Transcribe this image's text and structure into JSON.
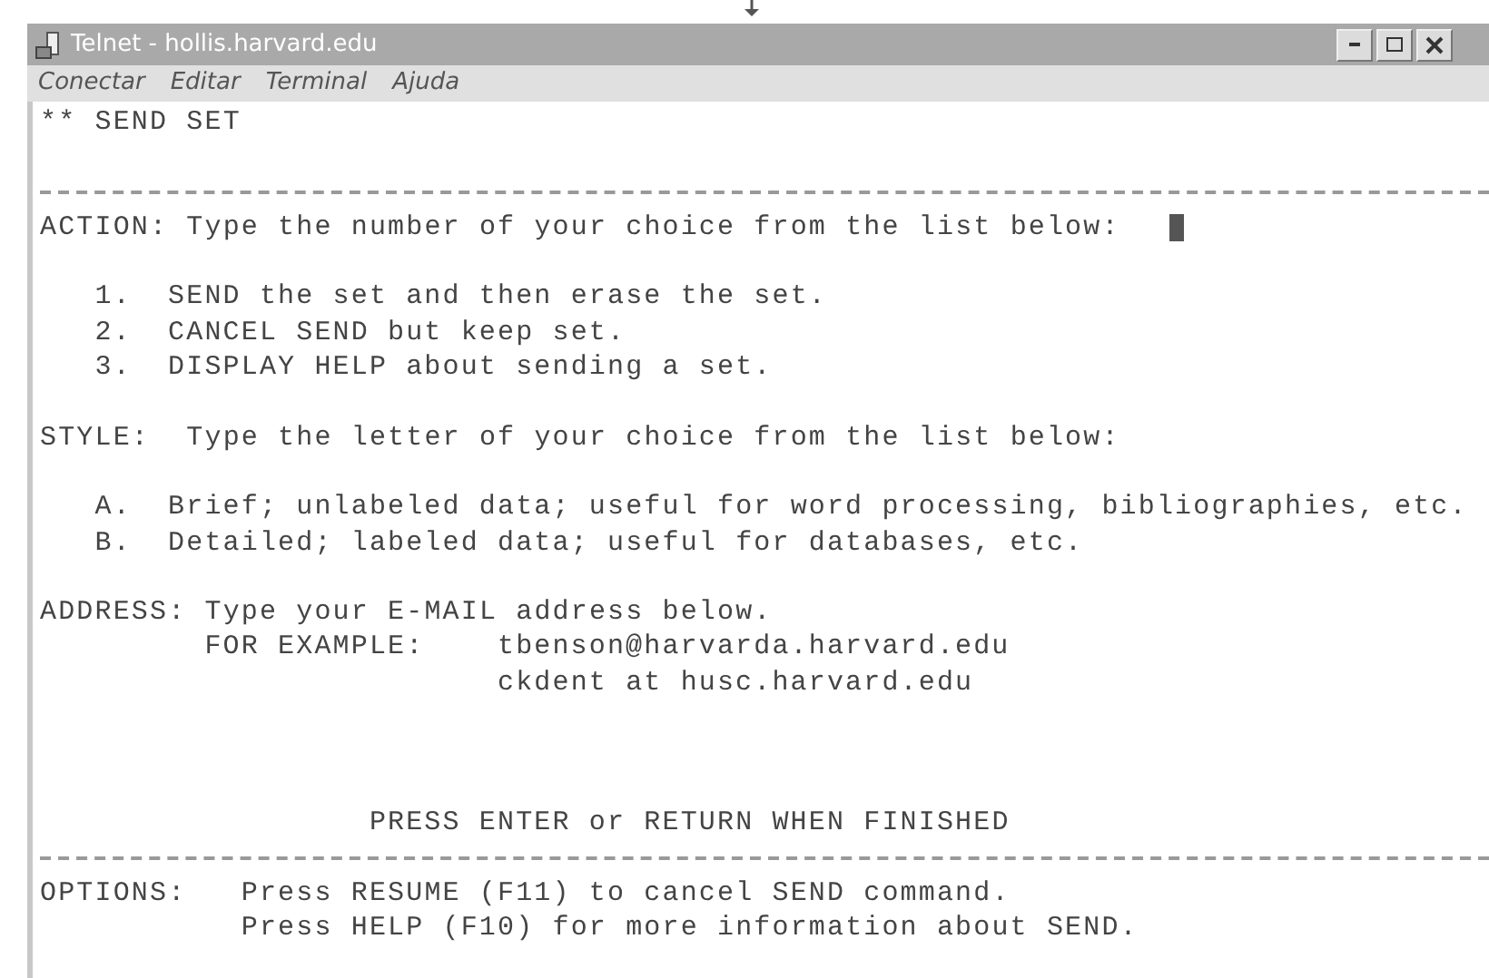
{
  "window": {
    "title": "Telnet - hollis.harvard.edu"
  },
  "menu": [
    {
      "label": "Conectar"
    },
    {
      "label": "Editar"
    },
    {
      "label": "Terminal"
    },
    {
      "label": "Ajuda"
    }
  ],
  "terminal": {
    "lines": [
      {
        "kind": "line",
        "text": "** SEND SET"
      },
      {
        "kind": "blank"
      },
      {
        "kind": "rule"
      },
      {
        "kind": "line",
        "text": "ACTION: Type the number of your choice from the list below:",
        "cursor": true
      },
      {
        "kind": "blank"
      },
      {
        "kind": "item",
        "marker": "1.",
        "text": "SEND the set and then erase the set."
      },
      {
        "kind": "item",
        "marker": "2.",
        "text": "CANCEL SEND but keep set."
      },
      {
        "kind": "item",
        "marker": "3.",
        "text": "DISPLAY HELP about sending a set."
      },
      {
        "kind": "blank"
      },
      {
        "kind": "line",
        "text": "STYLE:  Type the letter of your choice from the list below:"
      },
      {
        "kind": "blank"
      },
      {
        "kind": "item",
        "marker": "A.",
        "text": "Brief; unlabeled data; useful for word processing, bibliographies, etc."
      },
      {
        "kind": "item",
        "marker": "B.",
        "text": "Detailed; labeled data; useful for databases, etc."
      },
      {
        "kind": "blank"
      },
      {
        "kind": "line",
        "text": "ADDRESS: Type your E-MAIL address below."
      },
      {
        "kind": "example",
        "label": "FOR EXAMPLE:",
        "text": "tbenson@harvarda.harvard.edu"
      },
      {
        "kind": "example_more",
        "text": "ckdent at husc.harvard.edu"
      },
      {
        "kind": "blank"
      },
      {
        "kind": "blank"
      },
      {
        "kind": "blank"
      },
      {
        "kind": "center",
        "text": "PRESS ENTER or RETURN WHEN FINISHED"
      },
      {
        "kind": "rule"
      },
      {
        "kind": "option",
        "label": "OPTIONS:",
        "text": "Press RESUME (F11) to cancel SEND command."
      },
      {
        "kind": "option_more",
        "text": "Press HELP (F10) for more information about SEND."
      }
    ]
  }
}
